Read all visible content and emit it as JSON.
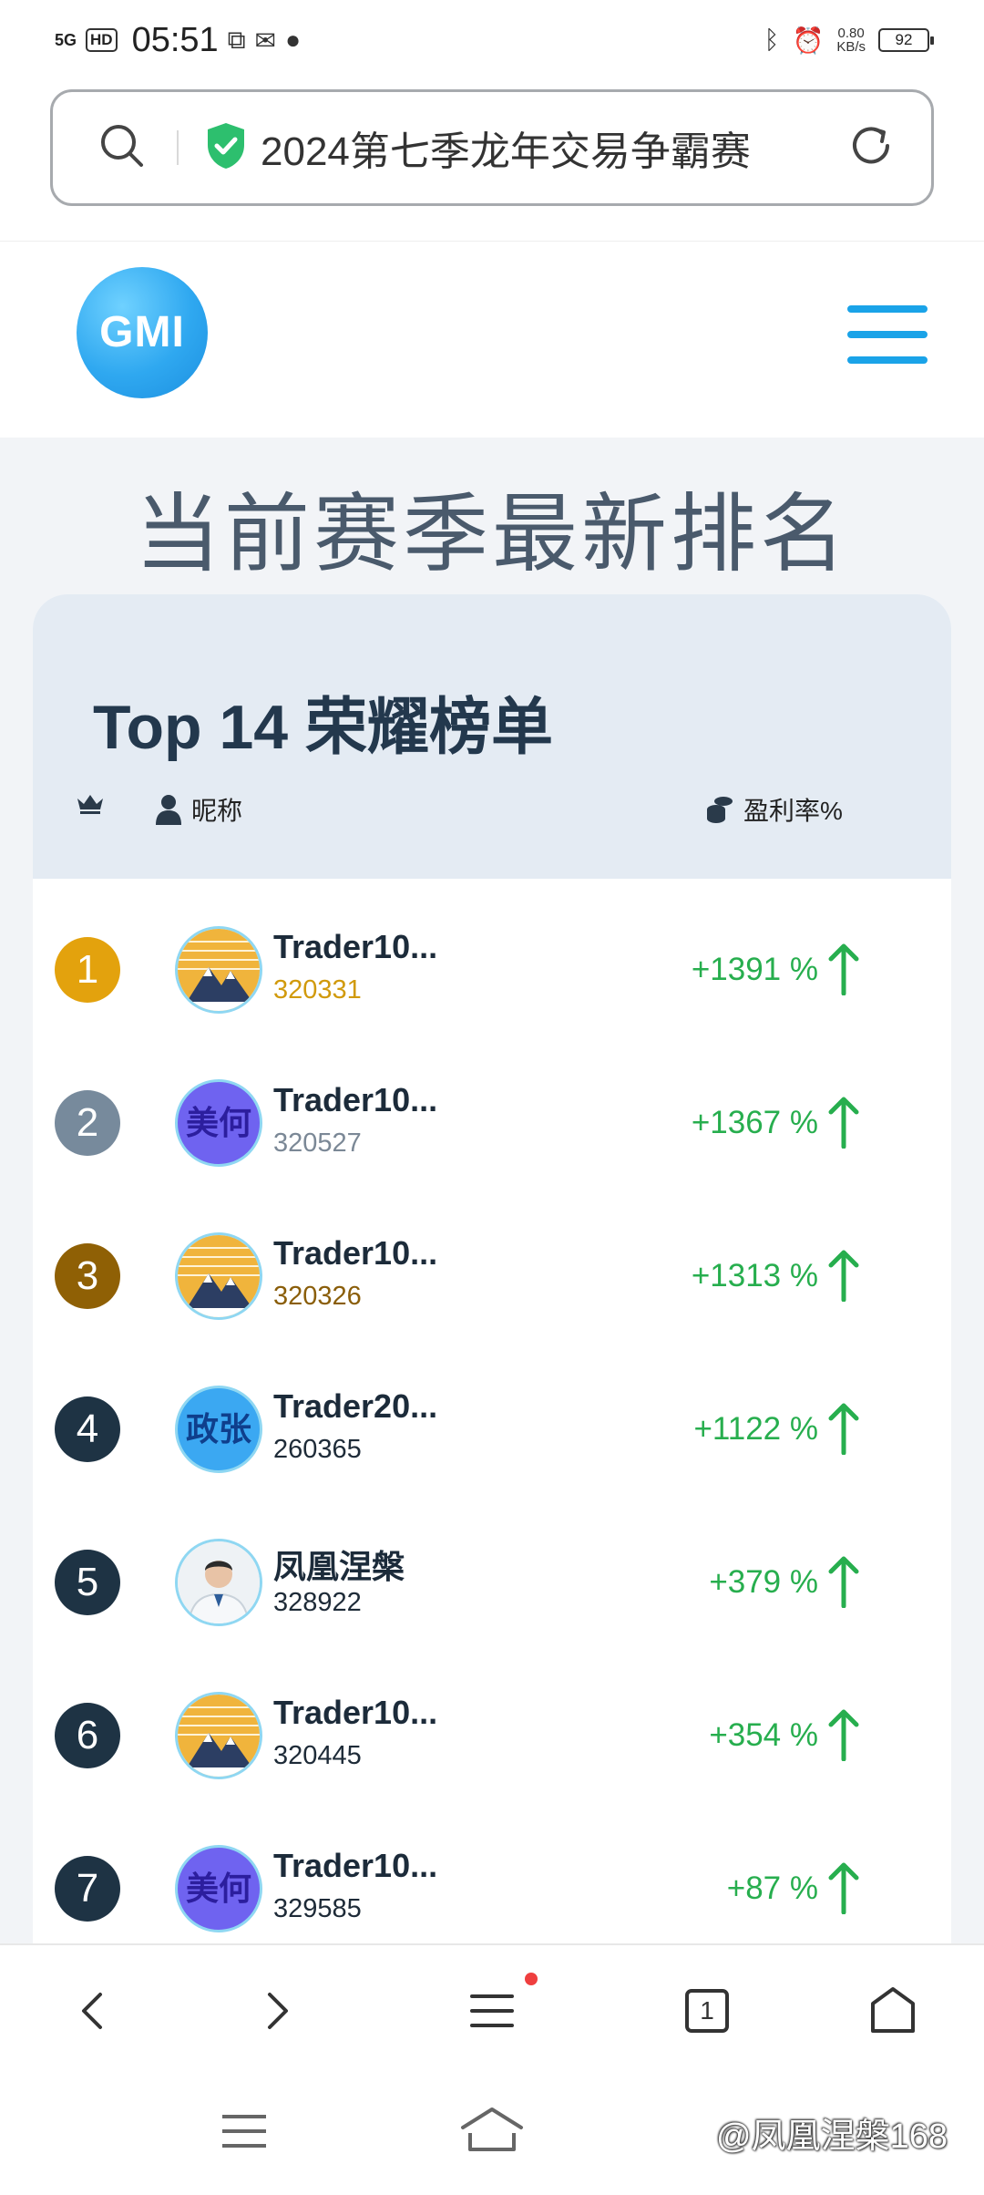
{
  "status_bar": {
    "signal": "5G",
    "hd": "HD",
    "time": "05:51",
    "net_speed_value": "0.80",
    "net_speed_unit": "KB/s",
    "battery": "92"
  },
  "browser": {
    "address_text": "2024第七季龙年交易争霸赛",
    "tabs_count": "1"
  },
  "site": {
    "logo_text": "GMI"
  },
  "page": {
    "headline": "当前赛季最新排名"
  },
  "leaderboard": {
    "title": "Top 14 荣耀榜单",
    "col_nickname": "昵称",
    "col_profit": "盈利率%",
    "rows": [
      {
        "rank": "1",
        "name": "Trader10...",
        "uid": "320331",
        "profit": "+1391 %",
        "avatar_type": "mountain",
        "avatar_text": "",
        "rank_color": "#e3a20d",
        "uid_color": "#d19a0c"
      },
      {
        "rank": "2",
        "name": "Trader10...",
        "uid": "320527",
        "profit": "+1367 %",
        "avatar_type": "text",
        "avatar_text": "美何",
        "rank_color": "#778a9c",
        "uid_color": "#7b8896"
      },
      {
        "rank": "3",
        "name": "Trader10...",
        "uid": "320326",
        "profit": "+1313 %",
        "avatar_type": "mountain",
        "avatar_text": "",
        "rank_color": "#8f6005",
        "uid_color": "#8a5e0a"
      },
      {
        "rank": "4",
        "name": "Trader20...",
        "uid": "260365",
        "profit": "+1122 %",
        "avatar_type": "text",
        "avatar_text": "政张",
        "rank_color": "#1e3344",
        "uid_color": "#1e2b38"
      },
      {
        "rank": "5",
        "name": "凤凰涅槃",
        "uid": "328922",
        "profit": "+379 %",
        "avatar_type": "photo",
        "avatar_text": "",
        "rank_color": "#1e3344",
        "uid_color": "#1e2b38"
      },
      {
        "rank": "6",
        "name": "Trader10...",
        "uid": "320445",
        "profit": "+354 %",
        "avatar_type": "mountain",
        "avatar_text": "",
        "rank_color": "#1e3344",
        "uid_color": "#1e2b38"
      },
      {
        "rank": "7",
        "name": "Trader10...",
        "uid": "329585",
        "profit": "+87 %",
        "avatar_type": "text",
        "avatar_text": "美何",
        "rank_color": "#1e3344",
        "uid_color": "#1e2b38"
      }
    ]
  },
  "watermark": "@凤凰涅槃168",
  "colors": {
    "accent": "#1aa3e8",
    "profit_green": "#27ae4e",
    "card_header": "#e4ebf3"
  }
}
